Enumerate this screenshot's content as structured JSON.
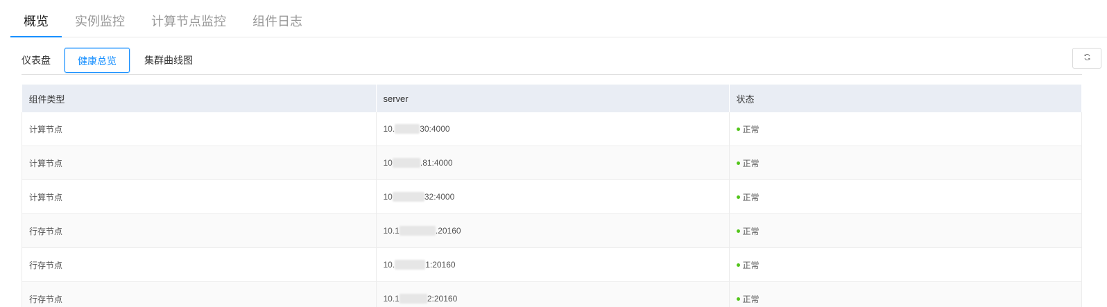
{
  "top_tabs": [
    {
      "label": "概览",
      "active": true
    },
    {
      "label": "实例监控",
      "active": false
    },
    {
      "label": "计算节点监控",
      "active": false
    },
    {
      "label": "组件日志",
      "active": false
    }
  ],
  "sub_tabs": [
    {
      "label": "仪表盘",
      "active": false
    },
    {
      "label": "健康总览",
      "active": true
    },
    {
      "label": "集群曲线图",
      "active": false
    }
  ],
  "refresh_icon": "refresh-icon",
  "table": {
    "headers": [
      "组件类型",
      "server",
      "状态"
    ],
    "rows": [
      {
        "type": "计算节点",
        "server_prefix": "10.",
        "server_suffix": "30:4000",
        "status": "正常"
      },
      {
        "type": "计算节点",
        "server_prefix": "10",
        "server_suffix": ".81:4000",
        "status": "正常"
      },
      {
        "type": "计算节点",
        "server_prefix": "10",
        "server_suffix": "32:4000",
        "status": "正常"
      },
      {
        "type": "行存节点",
        "server_prefix": "10.1",
        "server_suffix": ".20160",
        "status": "正常"
      },
      {
        "type": "行存节点",
        "server_prefix": "10.",
        "server_suffix": "1:20160",
        "status": "正常"
      },
      {
        "type": "行存节点",
        "server_prefix": "10.1",
        "server_suffix": "2:20160",
        "status": "正常"
      }
    ]
  },
  "colors": {
    "accent": "#1890ff",
    "status_ok": "#52c41a",
    "header_bg": "#e9edf4"
  }
}
